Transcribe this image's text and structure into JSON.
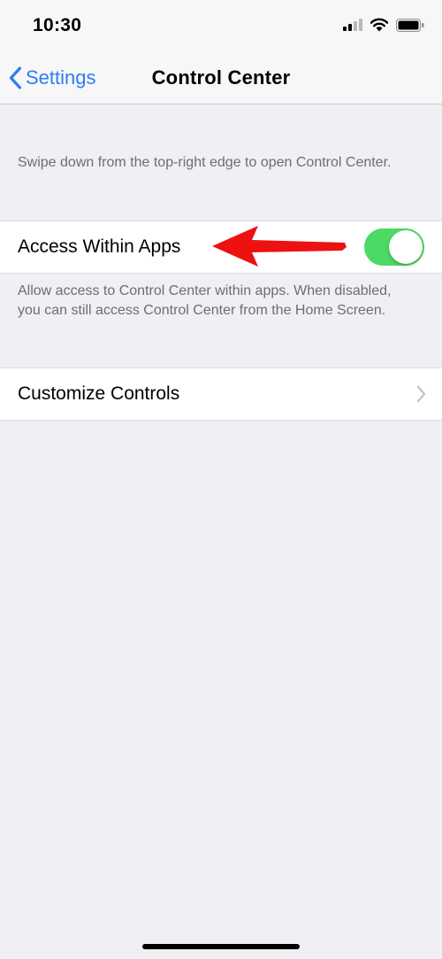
{
  "status_bar": {
    "time": "10:30",
    "icons": [
      "cellular-signal-icon",
      "wifi-icon",
      "battery-icon"
    ]
  },
  "nav": {
    "back_label": "Settings",
    "back_icon": "chevron-left-icon",
    "title": "Control Center"
  },
  "intro_footnote": "Swipe down from the top-right edge to open Control Center.",
  "access_row": {
    "label": "Access Within Apps",
    "toggle_state": "on"
  },
  "access_footnote": "Allow access to Control Center within apps. When disabled, you can still access Control Center from the Home Screen.",
  "customize_row": {
    "label": "Customize Controls",
    "icon": "chevron-right-icon"
  },
  "annotation": {
    "icon": "red-arrow-icon"
  },
  "colors": {
    "accent": "#2f7cf6",
    "toggle_on": "#4cd964",
    "background": "#efeff4",
    "annotation_arrow": "#ee1111"
  }
}
